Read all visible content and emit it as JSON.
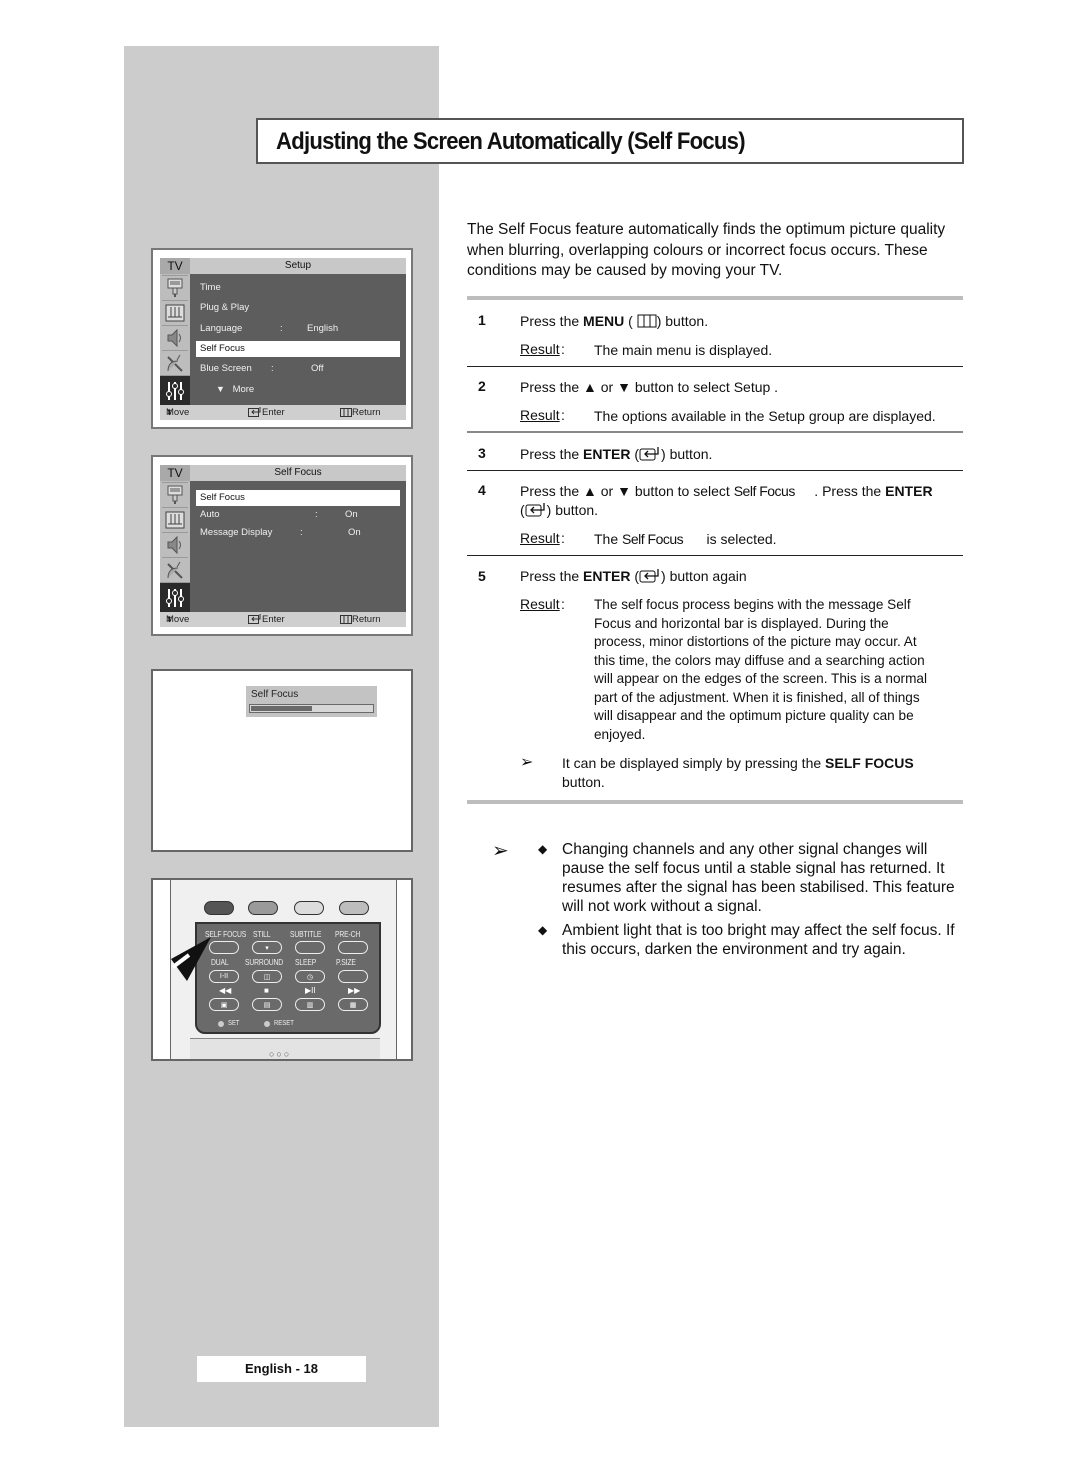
{
  "page": {
    "title": "Adjusting the Screen Automatically (Self Focus)",
    "page_number": "English - 18"
  },
  "intro": {
    "text": "The  Self Focus  feature automatically finds the optimum picture quality when blurring, overlapping colours or incorrect focus occurs. These conditions may be caused by moving your TV."
  },
  "steps": [
    {
      "number": "1",
      "parts": {
        "pre": "Press the ",
        "bold": "MENU",
        "post_icon_open": " (",
        "post": ")  button."
      },
      "result_label": "Result",
      "result": "The main menu is displayed."
    },
    {
      "number": "2",
      "text": "Press the ▲ or ▼ button to select Setup .",
      "result_label": "Result",
      "result": "The options available in the Setup  group are displayed."
    },
    {
      "number": "3",
      "parts": {
        "pre": "Press the ",
        "bold": "ENTER",
        "post": ") button."
      }
    },
    {
      "number": "4",
      "parts": {
        "pre": "Press the ▲ or ▼ button to select ",
        "item": "Self Focus",
        "mid": "     . Press the ",
        "bold": "ENTER",
        "line2_post": ") button."
      },
      "result_label": "Result",
      "result_pre": "The ",
      "result_item": "Self Focus",
      "result_post": "      is selected."
    },
    {
      "number": "5",
      "parts": {
        "pre": "Press the ",
        "bold": "ENTER",
        "post": ") button again"
      },
      "result_label": "Result",
      "result_lines": [
        "The self focus process begins with the message Self",
        "Focus  and horizontal bar is displayed. During the",
        "process, minor distortions of the picture may occur. At",
        "this time, the colors may diffuse and a searching action",
        "will appear on the edges of the screen. This is a normal",
        "part of the adjustment. When it is finished, all of things",
        "will disappear and the optimum picture quality can be",
        "enjoyed."
      ],
      "note": {
        "pre": "It can be displayed simply by pressing the ",
        "bold": "SELF FOCUS",
        "line2": "button."
      }
    }
  ],
  "notes": [
    "Changing channels and any other signal changes will pause the self focus until a stable signal has returned. It resumes after the signal has been stabilised. This feature will not work without a signal.",
    "Ambient light that is too bright may affect the self focus. If this occurs, darken the environment and try again."
  ],
  "osd_setup": {
    "tv_label": "TV",
    "header": "Setup",
    "items": [
      {
        "label": "Time"
      },
      {
        "label": "Plug & Play"
      },
      {
        "label": "Language",
        "colon": ":",
        "value": "English"
      },
      {
        "label": "Self Focus",
        "selected": true
      },
      {
        "label": "Blue Screen",
        "colon": ":",
        "value": "Off"
      },
      {
        "label": "More",
        "icon": "triangle-down"
      }
    ],
    "footer": {
      "move": "Move",
      "enter": "Enter",
      "return": "Return"
    }
  },
  "osd_selffocus": {
    "tv_label": "TV",
    "header": "Self Focus",
    "items": [
      {
        "label": "Self Focus",
        "selected": true
      },
      {
        "label": "Auto",
        "colon": ":",
        "value": "On"
      },
      {
        "label": "Message Display",
        "colon": ":",
        "value": "On"
      }
    ],
    "footer": {
      "move": "Move",
      "enter": "Enter",
      "return": "Return"
    }
  },
  "progress_osd": {
    "label": "Self Focus",
    "progress_fraction": 0.5
  },
  "remote": {
    "color_buttons": [
      "#555555",
      "#9a9a9a",
      "#dcdcdc",
      "#bdbdbd"
    ],
    "row1": [
      "SELF FOCUS",
      "STILL",
      "SUBTITLE",
      "PRE-CH"
    ],
    "row2": [
      "DUAL",
      "SURROUND",
      "SLEEP",
      "P.SIZE"
    ],
    "row2_button_text": [
      "I-II",
      "",
      "",
      ""
    ],
    "row3_symbols": [
      "◀◀",
      "■",
      "▶II",
      "▶▶"
    ],
    "set_label": "SET",
    "reset_label": "RESET",
    "dots": "○○○"
  }
}
